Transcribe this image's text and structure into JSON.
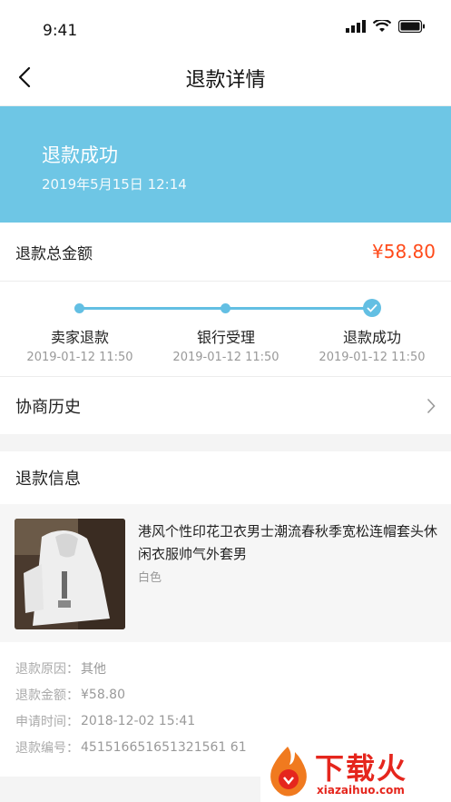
{
  "status_bar": {
    "time": "9:41"
  },
  "nav": {
    "title": "退款详情"
  },
  "banner": {
    "title": "退款成功",
    "date": "2019年5月15日  12:14"
  },
  "total": {
    "label": "退款总金额",
    "amount": "¥58.80",
    "amount_color": "#ff4a1a"
  },
  "progress": {
    "accent_color": "#63bfe3",
    "steps": [
      {
        "label": "卖家退款",
        "time": "2019-01-12 11:50"
      },
      {
        "label": "银行受理",
        "time": "2019-01-12 11:50"
      },
      {
        "label": "退款成功",
        "time": "2019-01-12 11:50"
      }
    ]
  },
  "history": {
    "label": "协商历史"
  },
  "refund_info": {
    "section_title": "退款信息",
    "product": {
      "title": "港风个性印花卫衣男士潮流春秋季宽松连帽套头休闲衣服帅气外套男",
      "color": "白色"
    },
    "rows": [
      {
        "key": "退款原因：",
        "value": "其他"
      },
      {
        "key": "退款金额：",
        "value": "¥58.80"
      },
      {
        "key": "申请时间：",
        "value": "2018-12-02   15:41"
      },
      {
        "key": "退款编号：",
        "value": "451516651651321561 61"
      }
    ]
  },
  "watermark": {
    "brand": "下载火",
    "url": "xiazaihuo.com"
  }
}
